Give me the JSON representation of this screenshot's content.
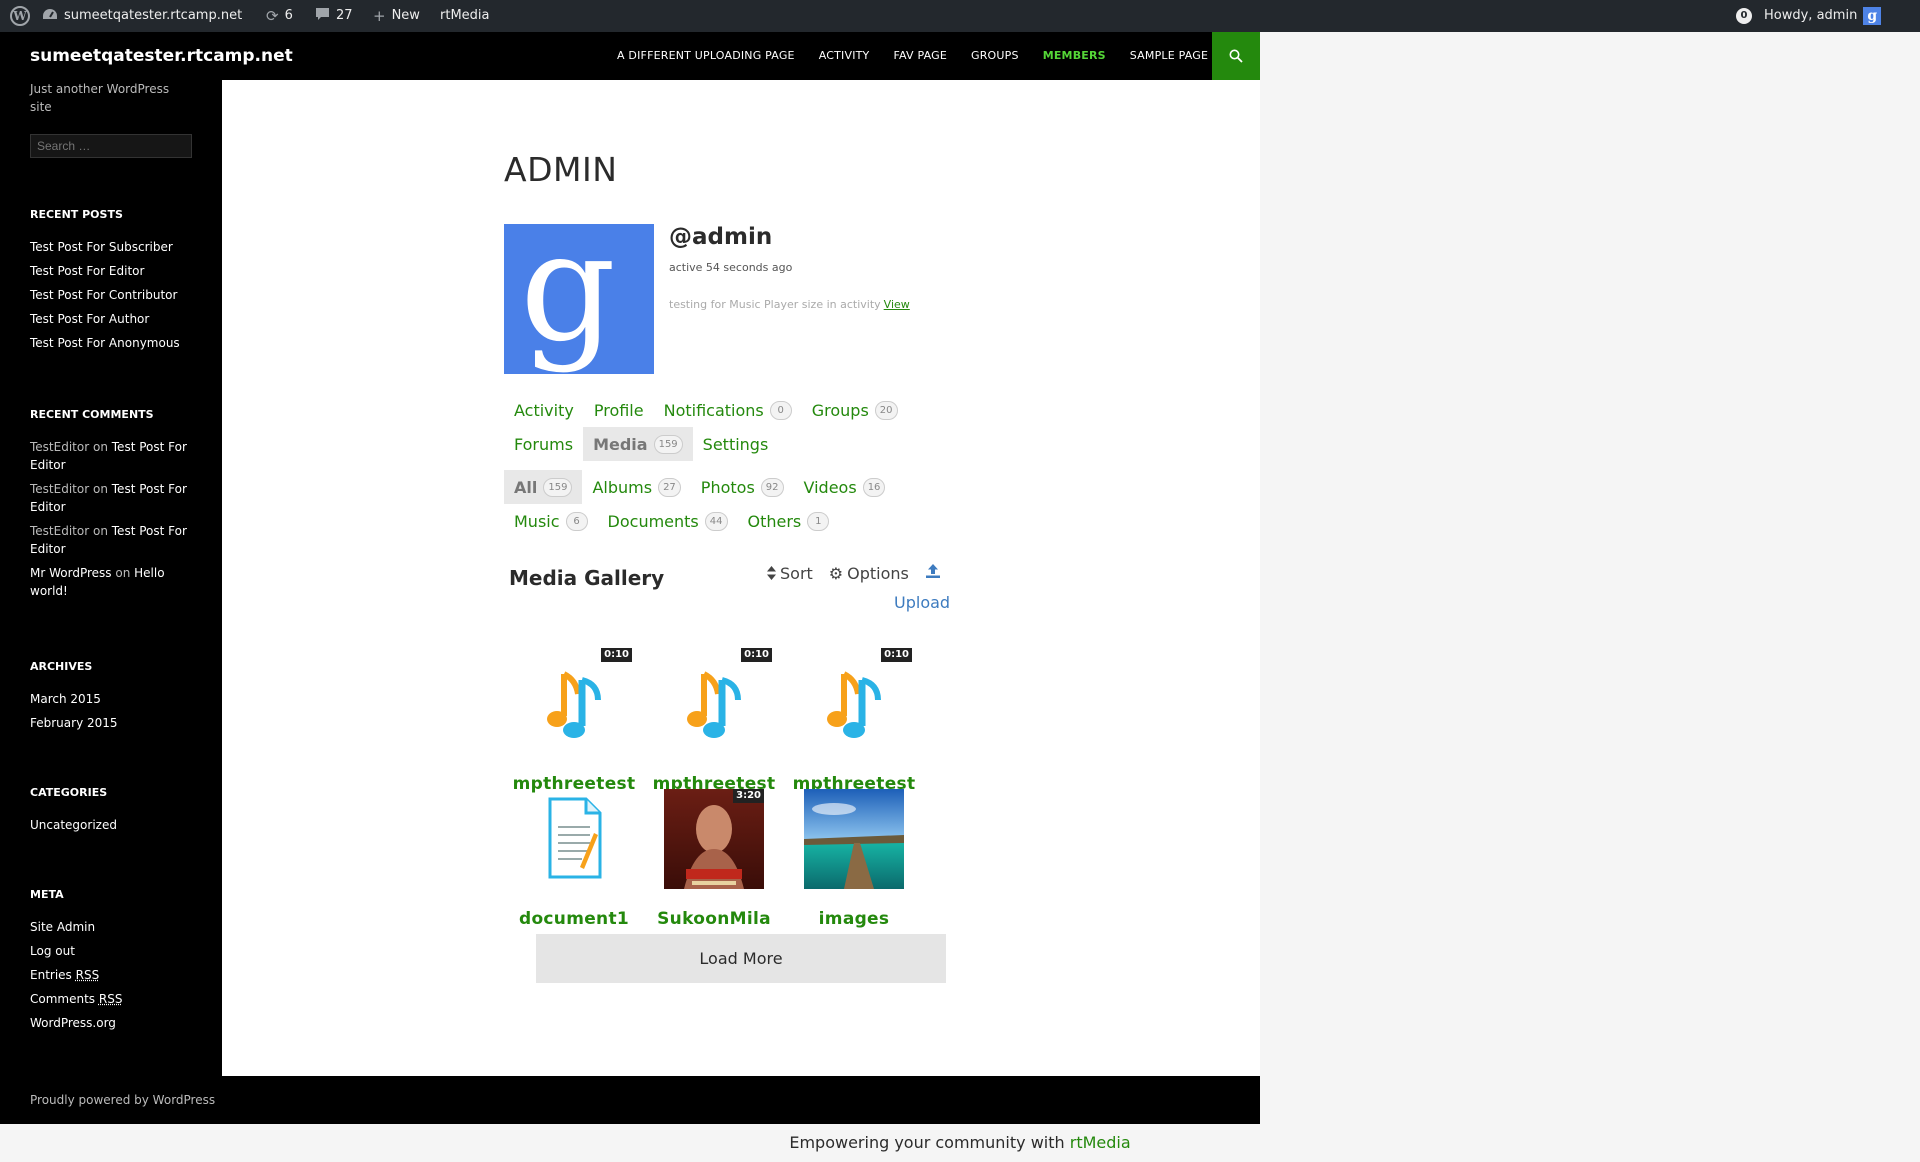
{
  "adminbar": {
    "site_name": "sumeetqatester.rtcamp.net",
    "updates_count": "6",
    "comments_count": "27",
    "new_label": "New",
    "rtmedia_label": "rtMedia",
    "notifications_count": "0",
    "howdy": "Howdy, admin"
  },
  "site": {
    "title": "sumeetqatester.rtcamp.net",
    "description": "Just another WordPress site",
    "search_placeholder": "Search …"
  },
  "primary_nav": [
    {
      "label": "A Different Uploading Page"
    },
    {
      "label": "Activity"
    },
    {
      "label": "Fav Page"
    },
    {
      "label": "Groups"
    },
    {
      "label": "Members"
    },
    {
      "label": "Sample Page"
    }
  ],
  "sidebar": {
    "recent_posts_title": "Recent Posts",
    "recent_posts": [
      "Test Post For Subscriber",
      "Test Post For Editor",
      "Test Post For Contributor",
      "Test Post For Author",
      "Test Post For Anonymous"
    ],
    "recent_comments_title": "Recent Comments",
    "recent_comments": [
      {
        "author": "TestEditor",
        "on": "on",
        "post": "Test Post For Editor"
      },
      {
        "author": "TestEditor",
        "on": "on",
        "post": "Test Post For Editor"
      },
      {
        "author": "TestEditor",
        "on": "on",
        "post": "Test Post For Editor"
      },
      {
        "author": "Mr WordPress",
        "on": "on",
        "post": "Hello world!"
      }
    ],
    "archives_title": "Archives",
    "archives": [
      "March 2015",
      "February 2015"
    ],
    "categories_title": "Categories",
    "categories": [
      "Uncategorized"
    ],
    "meta_title": "Meta",
    "meta": {
      "site_admin": "Site Admin",
      "log_out": "Log out",
      "entries": "Entries",
      "comments": "Comments",
      "rss": "RSS",
      "wordpress_org": "WordPress.org"
    }
  },
  "profile": {
    "title": "ADMIN",
    "handle": "@admin",
    "activity": "active 54 seconds ago",
    "latest_update": "testing for Music Player size in activity",
    "view_link": "View",
    "tabs": [
      {
        "label": "Activity",
        "count": null
      },
      {
        "label": "Profile",
        "count": null
      },
      {
        "label": "Notifications",
        "count": "0"
      },
      {
        "label": "Groups",
        "count": "20"
      },
      {
        "label": "Forums",
        "count": null
      },
      {
        "label": "Media",
        "count": "159"
      },
      {
        "label": "Settings",
        "count": null
      }
    ],
    "subtabs": [
      {
        "label": "All",
        "count": "159"
      },
      {
        "label": "Albums",
        "count": "27"
      },
      {
        "label": "Photos",
        "count": "92"
      },
      {
        "label": "Videos",
        "count": "16"
      },
      {
        "label": "Music",
        "count": "6"
      },
      {
        "label": "Documents",
        "count": "44"
      },
      {
        "label": "Others",
        "count": "1"
      }
    ]
  },
  "gallery": {
    "title": "Media Gallery",
    "sort_label": "Sort",
    "options_label": "Options",
    "upload_label": "Upload",
    "load_more": "Load More",
    "items": [
      {
        "title": "mpthreetest",
        "type": "music-icon",
        "duration": "0:10"
      },
      {
        "title": "mpthreetest",
        "type": "music-icon",
        "duration": "0:10"
      },
      {
        "title": "mpthreetest",
        "type": "music-icon",
        "duration": "0:10"
      },
      {
        "title": "document1",
        "type": "document-icon",
        "duration": null
      },
      {
        "title": "SukoonMila",
        "type": "video-thumbnail",
        "duration": "3:20"
      },
      {
        "title": "images",
        "type": "photo-thumbnail",
        "duration": null
      }
    ]
  },
  "footer": {
    "credit": "Proudly powered by WordPress",
    "rtmedia_text": "Empowering your community with",
    "rtmedia_link": "rtMedia"
  },
  "colors": {
    "accent_green": "#24890d",
    "nav_active": "#55d737",
    "adminbar_bg": "#23282d",
    "link_blue": "#3d7bbf"
  }
}
